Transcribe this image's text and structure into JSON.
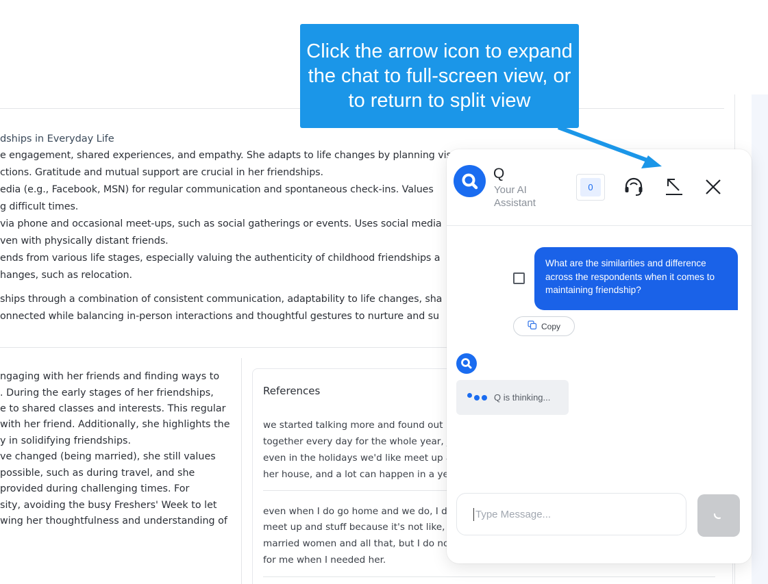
{
  "document": {
    "top_lines": [
      "dships in Everyday Life",
      "e engagement, shared experiences, and empathy. She adapts to life changes by planning vis",
      "ctions. Gratitude and mutual support are crucial in her friendships.",
      "edia (e.g., Facebook, MSN) for regular communication and spontaneous check-ins. Values",
      "g difficult times.",
      " via phone and occasional meet-ups, such as social gatherings or events. Uses social media",
      "ven with physically distant friends.",
      "ends from various life stages, especially valuing the authenticity of childhood friendships a",
      "hanges, such as relocation.",
      "ships through a combination of consistent communication, adaptability to life changes, sha",
      "onnected while balancing in-person interactions and thoughtful gestures to nurture and su"
    ],
    "left_column": [
      "ngaging with her friends and finding ways to",
      ". During the early stages of her friendships,",
      "e to shared classes and interests. This regular",
      "with her friend. Additionally, she highlights the",
      "y in solidifying friendships.",
      "ve changed (being married), she still values",
      "possible, such as during travel, and she",
      "provided during challenging times. For",
      "sity, avoiding the busy Freshers' Week to let",
      "wing her thoughtfulness and understanding of"
    ],
    "references": {
      "title": "References",
      "quote1": [
        "we started talking more and found out",
        "together every day for the whole year, j",
        "even in the holidays we'd like meet up a",
        "her house, and a lot can happen in a yea"
      ],
      "quote2": [
        "even when I do go home and we do, I do",
        "meet up and stuff because it's not like,",
        "married women and all that, but I do no",
        "for me when I needed her."
      ]
    }
  },
  "callout": {
    "text": "Click the arrow icon to expand the chat to full-screen view, or to return to split view"
  },
  "chat": {
    "title": "Q",
    "subtitle": "Your AI Assistant",
    "counter": "0",
    "user_message": "What are the similarities and difference across the respondents when it comes to maintaining friendship?",
    "copy_label": "Copy",
    "thinking_text": "Q is thinking...",
    "input_placeholder": "Type Message...",
    "accent_color": "#1a6cf0",
    "icons": {
      "logo": "search-icon",
      "support": "headset-icon",
      "expand": "expand-arrow-icon",
      "close": "close-icon",
      "copy": "copy-icon",
      "send": "loading-spinner-icon"
    }
  }
}
